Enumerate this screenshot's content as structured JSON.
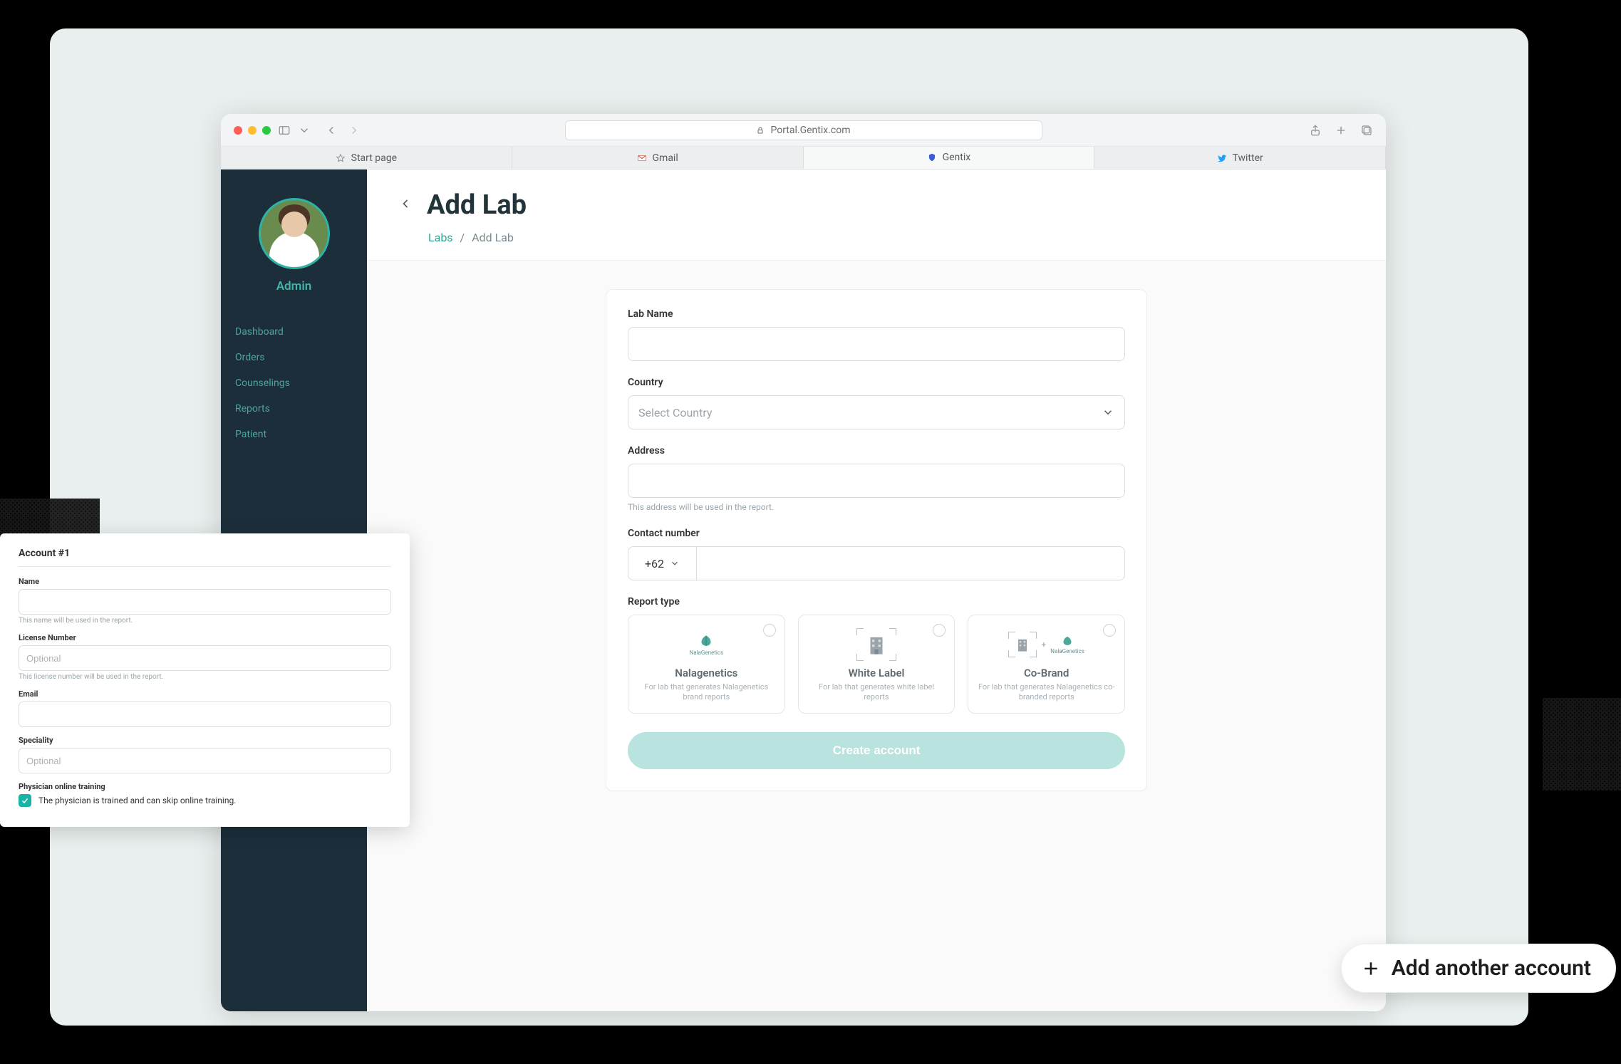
{
  "browser": {
    "url": "Portal.Gentix.com",
    "tabs": [
      {
        "label": "Start page",
        "icon": "star"
      },
      {
        "label": "Gmail",
        "icon": "gmail"
      },
      {
        "label": "Gentix",
        "icon": "shield"
      },
      {
        "label": "Twitter",
        "icon": "twitter"
      }
    ]
  },
  "sidebar": {
    "role": "Admin",
    "items": [
      "Dashboard",
      "Orders",
      "Counselings",
      "Reports",
      "Patient"
    ]
  },
  "header": {
    "title": "Add Lab",
    "crumb_root": "Labs",
    "crumb_sep": "/",
    "crumb_leaf": "Add Lab"
  },
  "form": {
    "lab_name_label": "Lab Name",
    "country_label": "Country",
    "country_placeholder": "Select Country",
    "address_label": "Address",
    "address_hint": "This address will be used in the report.",
    "contact_label": "Contact number",
    "phone_code": "+62",
    "report_label": "Report type",
    "reports": [
      {
        "name": "Nalagenetics",
        "desc": "For lab that generates Nalagenetics brand reports",
        "sub": "NalaGenetics"
      },
      {
        "name": "White Label",
        "desc": "For lab that generates white label reports"
      },
      {
        "name": "Co-Brand",
        "desc": "For lab that generates Nalagenetics co-branded reports",
        "sub": "NalaGenetics"
      }
    ],
    "create_btn": "Create account"
  },
  "account_panel": {
    "title": "Account #1",
    "name_label": "Name",
    "name_hint": "This name will be used in the report.",
    "license_label": "License Number",
    "license_placeholder": "Optional",
    "license_hint": "This license number will be used in the report.",
    "email_label": "Email",
    "speciality_label": "Speciality",
    "speciality_placeholder": "Optional",
    "training_label": "Physician online training",
    "training_checkbox": "The physician is trained and can skip online training."
  },
  "fab": {
    "label": "Add another account"
  }
}
